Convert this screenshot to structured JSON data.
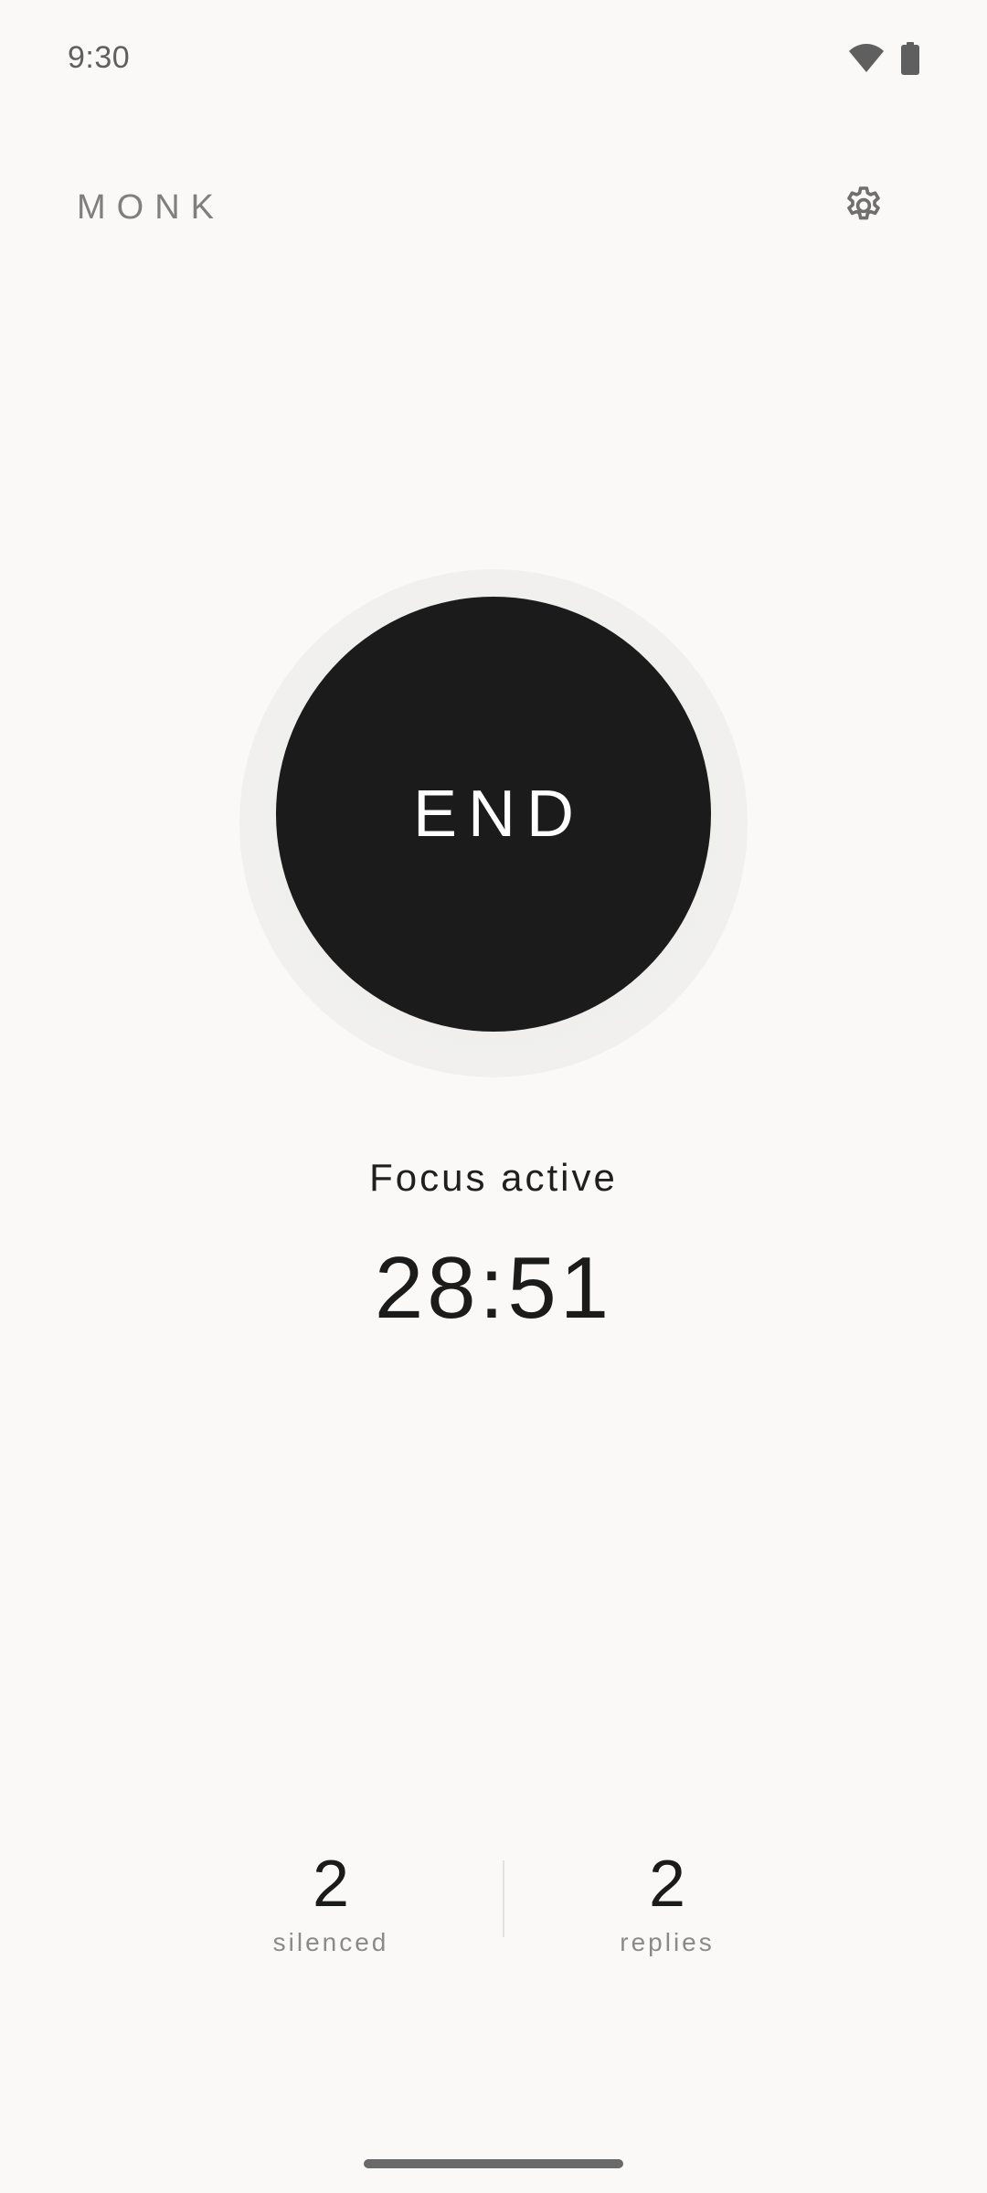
{
  "status_bar": {
    "time": "9:30",
    "icons": [
      "wifi-icon",
      "battery-icon"
    ]
  },
  "header": {
    "app_title": "MONK",
    "settings_icon": "gear-icon"
  },
  "main": {
    "end_button_label": "END",
    "focus_status": "Focus active",
    "timer": "28:51"
  },
  "stats": {
    "silenced": {
      "value": "2",
      "label": "silenced"
    },
    "replies": {
      "value": "2",
      "label": "replies"
    }
  },
  "colors": {
    "background": "#faf9f7",
    "primary": "#1b1b1b",
    "muted_text": "#7f7f7f"
  }
}
